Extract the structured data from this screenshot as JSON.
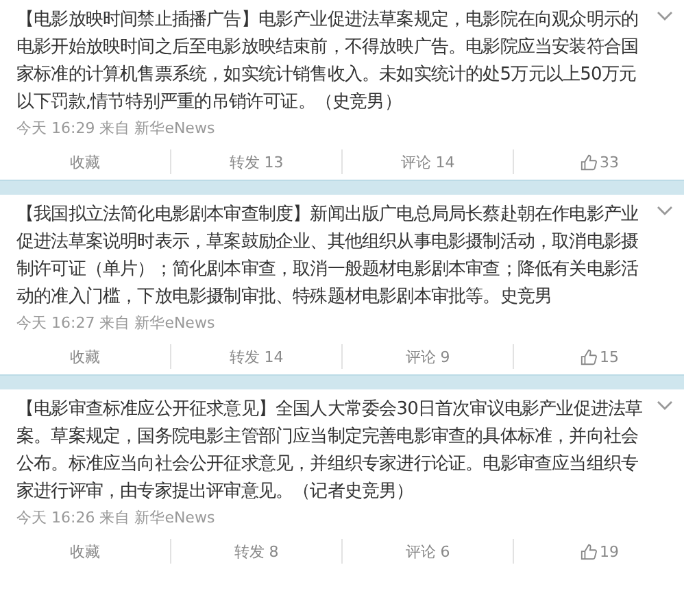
{
  "posts": [
    {
      "text": "【电影放映时间禁止插播广告】电影产业促进法草案规定，电影院在向观众明示的电影开始放映时间之后至电影放映结束前，不得放映广告。电影院应当安装符合国家标准的计算机售票系统，如实统计销售收入。未如实统计的处5万元以上50万元以下罚款,情节特别严重的吊销许可证。（史竞男）",
      "meta": "今天 16:29 来自 新华eNews",
      "favorite": "收藏",
      "repost": "转发 13",
      "comment": "评论 14",
      "likes": "33"
    },
    {
      "text": "【我国拟立法简化电影剧本审查制度】新闻出版广电总局局长蔡赴朝在作电影产业促进法草案说明时表示，草案鼓励企业、其他组织从事电影摄制活动，取消电影摄制许可证（单片）；简化剧本审查，取消一般题材电影剧本审查；降低有关电影活动的准入门槛，下放电影摄制审批、特殊题材电影剧本审批等。史竞男",
      "meta": "今天 16:27 来自 新华eNews",
      "favorite": "收藏",
      "repost": "转发 14",
      "comment": "评论 9",
      "likes": "15"
    },
    {
      "text": "【电影审查标准应公开征求意见】全国人大常委会30日首次审议电影产业促进法草案。草案规定，国务院电影主管部门应当制定完善电影审查的具体标准，并向社会公布。标准应当向社会公开征求意见，并组织专家进行论证。电影审查应当组织专家进行评审，由专家提出评审意见。（记者史竞男）",
      "meta": "今天 16:26 来自 新华eNews",
      "favorite": "收藏",
      "repost": "转发 8",
      "comment": "评论 6",
      "likes": "19"
    }
  ]
}
